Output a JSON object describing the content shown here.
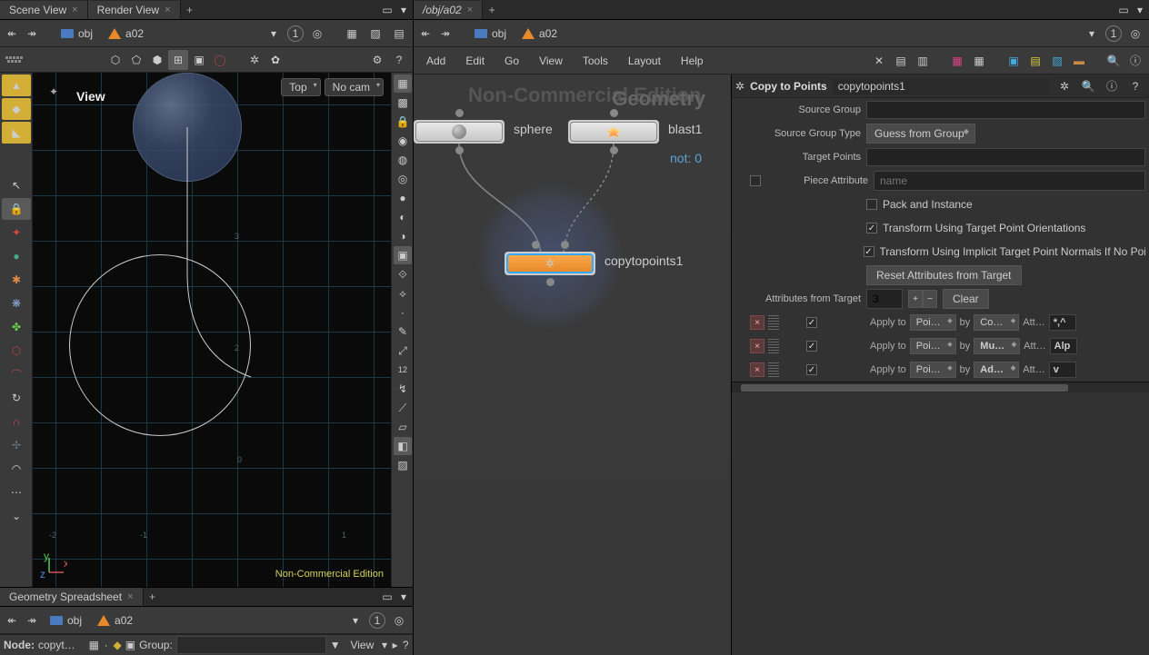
{
  "left_tabs": {
    "scene": "Scene View",
    "render": "Render View"
  },
  "right_tabs": {
    "network": "/obj/a02"
  },
  "path": {
    "obj": "obj",
    "node": "a02"
  },
  "pin_number": "1",
  "viewport": {
    "label": "View",
    "top_drop": "Top",
    "cam_drop": "No cam",
    "nc": "Non-Commercial Edition",
    "axis_labels": {
      "neg2": "-2",
      "neg1": "-1",
      "one": "1",
      "two": "2",
      "zero": "0",
      "three": "3"
    }
  },
  "menus": {
    "add": "Add",
    "edit": "Edit",
    "go": "Go",
    "view": "View",
    "tools": "Tools",
    "layout": "Layout",
    "help": "Help"
  },
  "network": {
    "watermark": "Non-Commercial Edition",
    "geometry": "Geometry",
    "sphere": "sphere",
    "blast": "blast1",
    "copy": "copytopoints1",
    "not0": "not: 0"
  },
  "params": {
    "title": "Copy to Points",
    "nodename": "copytopoints1",
    "source_group": "Source Group",
    "source_group_type": "Source Group Type",
    "source_group_type_val": "Guess from Group",
    "target_points": "Target Points",
    "piece_attr": "Piece Attribute",
    "piece_placeholder": "name",
    "pack": "Pack and Instance",
    "transform_orient": "Transform Using Target Point Orientations",
    "transform_implicit": "Transform Using Implicit Target Point Normals If No Poin",
    "reset_button": "Reset Attributes from Target",
    "attrs_from_target": "Attributes from Target",
    "attrs_count": "3",
    "clear": "Clear",
    "apply_to": "Apply to",
    "by": "by",
    "att": "Att…",
    "poi": "Poi…",
    "rows": [
      {
        "by_val": "Co…",
        "attr": "*,^"
      },
      {
        "by_val": "Mu…",
        "attr": "Alp"
      },
      {
        "by_val": "Ad…",
        "attr": "v"
      }
    ]
  },
  "spreadsheet": {
    "tab": "Geometry Spreadsheet",
    "node_lbl": "Node:",
    "node_val": "copyt…",
    "group_lbl": "Group:",
    "view": "View"
  }
}
